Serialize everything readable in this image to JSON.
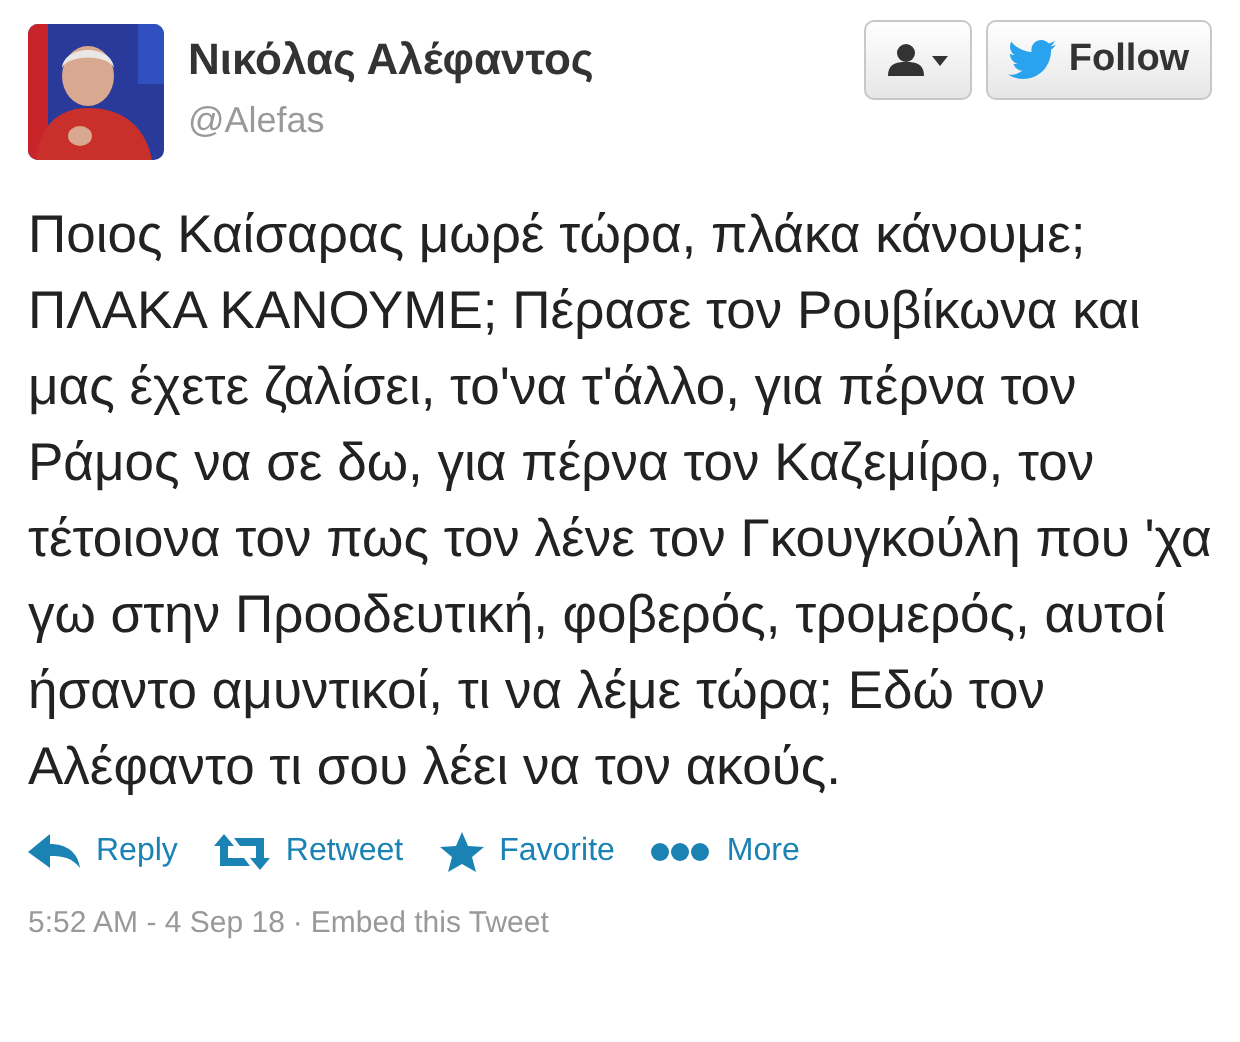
{
  "author": {
    "name": "Νικόλας Αλέφαντος",
    "handle": "@Alefas"
  },
  "buttons": [
    {
      "kind": "user-menu"
    },
    {
      "kind": "follow",
      "label": "Follow"
    }
  ],
  "tweet": {
    "text": "Ποιος Καίσαρας μωρέ τώρα, πλάκα κάνουμε; ΠΛΑΚΑ ΚΑΝΟΥΜΕ; Πέρασε τον Ρουβίκωνα και μας έχετε ζαλίσει, το'να τ'άλλο, για πέρνα τον Ράμος να σε δω, για πέρνα τον Καζεμίρο, τον τέτοιονα τον πως τον λένε τον Γκουγκούλη που 'χα γω στην Προοδευτική, φοβερός, τρομερός, αυτοί ήσαντο αμυντικοί, τι να λέμε τώρα; Εδώ τον Αλέφαντο τι σου λέει να τον ακούς."
  },
  "actions": [
    {
      "kind": "reply",
      "label": "Reply"
    },
    {
      "kind": "retweet",
      "label": "Retweet"
    },
    {
      "kind": "favorite",
      "label": "Favorite"
    },
    {
      "kind": "more",
      "label": "More"
    }
  ],
  "footer": {
    "timestamp": "5:52 AM - 4 Sep 18",
    "separator": "·",
    "embed": "Embed this Tweet"
  }
}
